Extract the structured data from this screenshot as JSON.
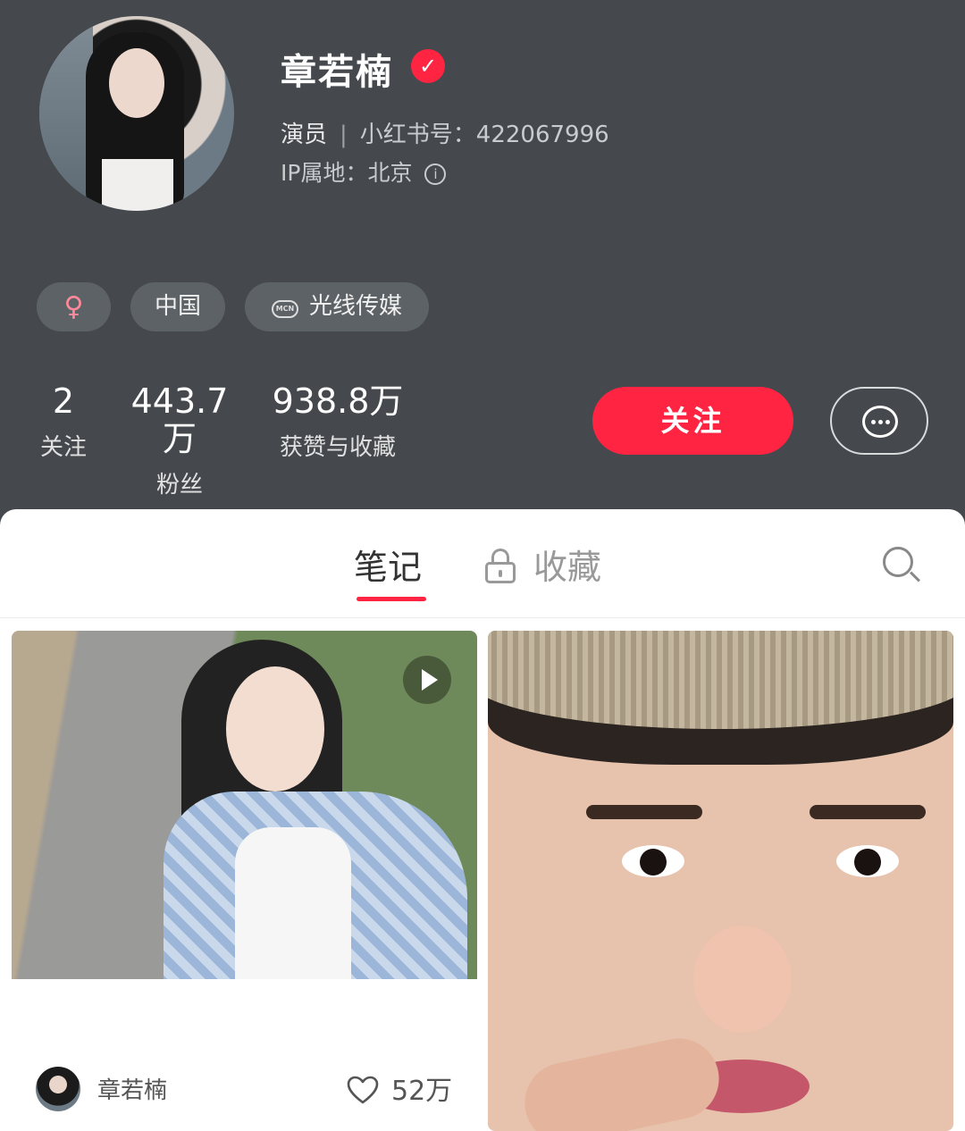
{
  "profile": {
    "name": "章若楠",
    "verified": true,
    "role": "演员",
    "id_label": "小红书号：422067996",
    "ip_label": "IP属地：北京",
    "tags": {
      "gender_symbol": "♀",
      "region": "中国",
      "mcn_badge": "MCN",
      "mcn": "光线传媒"
    }
  },
  "stats": [
    {
      "value": "2",
      "label": "关注"
    },
    {
      "value": "443.7万",
      "label": "粉丝"
    },
    {
      "value": "938.8万",
      "label": "获赞与收藏"
    }
  ],
  "actions": {
    "follow": "关注",
    "message_icon": "chat-bubble-icon"
  },
  "tabs": {
    "notes": "笔记",
    "collections": "收藏",
    "active": "notes"
  },
  "notes": [
    {
      "author": "章若楠",
      "likes": "52万",
      "is_video": true
    },
    {
      "is_video": false
    }
  ],
  "colors": {
    "accent": "#ff2442",
    "header_bg": "#45494d"
  }
}
